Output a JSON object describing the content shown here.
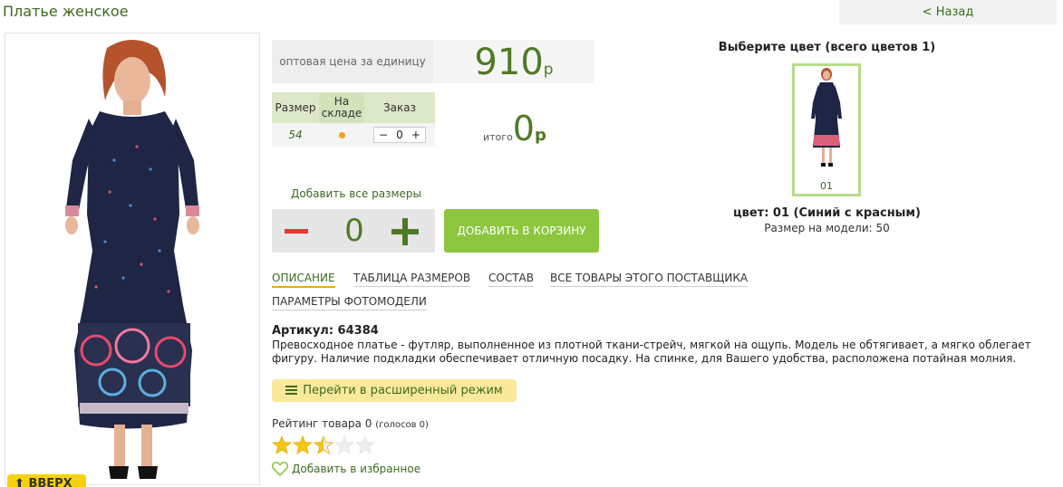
{
  "header": {
    "title": "Платье женское",
    "back_label": "< Назад"
  },
  "price": {
    "label": "оптовая цена за единицу",
    "value": "910",
    "currency": "р"
  },
  "size_table": {
    "headers": {
      "size": "Размер",
      "stock": "На складе",
      "order": "Заказ"
    },
    "rows": [
      {
        "size": "54",
        "stock_icon": "dot-in-stock",
        "order_minus": "−",
        "order_qty": "0",
        "order_plus": "+"
      }
    ]
  },
  "total": {
    "label": "итого",
    "value": "0",
    "currency": "р"
  },
  "add_all_label": "Добавить все размеры",
  "big_stepper": {
    "value": "0"
  },
  "cart_button_label": "ДОБАВИТЬ В КОРЗИНУ",
  "tabs": [
    {
      "label": "ОПИСАНИЕ",
      "active": true
    },
    {
      "label": "ТАБЛИЦА РАЗМЕРОВ"
    },
    {
      "label": "СОСТАВ"
    },
    {
      "label": "ВСЕ ТОВАРЫ ЭТОГО ПОСТАВЩИКА"
    },
    {
      "label": "ПАРАМЕТРЫ ФОТОМОДЕЛИ"
    }
  ],
  "description": {
    "sku": "Артикул: 64384",
    "text": "Превосходное платье - футляр, выполненное из плотной ткани-стрейч, мягкой на ощупь. Модель не обтягивает, а мягко облегает фигуру. Наличие подкладки обеспечивает отличную посадку. На спинке, для Вашего удобства, расположена потайная молния."
  },
  "advanced_mode_label": "Перейти в расширенный режим",
  "rating": {
    "label": "Рейтинг товара 0",
    "votes": "(голосов 0)",
    "filled_stars": 2.5,
    "max_stars": 5
  },
  "favorites_label": "Добавить в избранное",
  "up_button_label": "ВВЕРХ",
  "color_chooser": {
    "title": "Выберите цвет (всего цветов 1)",
    "swatch_code": "01",
    "selected": "цвет: 01 (Синий с красным)",
    "model_size": "Размер на модели: 50"
  },
  "colors": {
    "accent_green": "#8cc63e",
    "text_green": "#4f7a25",
    "star_yellow": "#f5c518",
    "minus_red": "#e53a2f"
  }
}
